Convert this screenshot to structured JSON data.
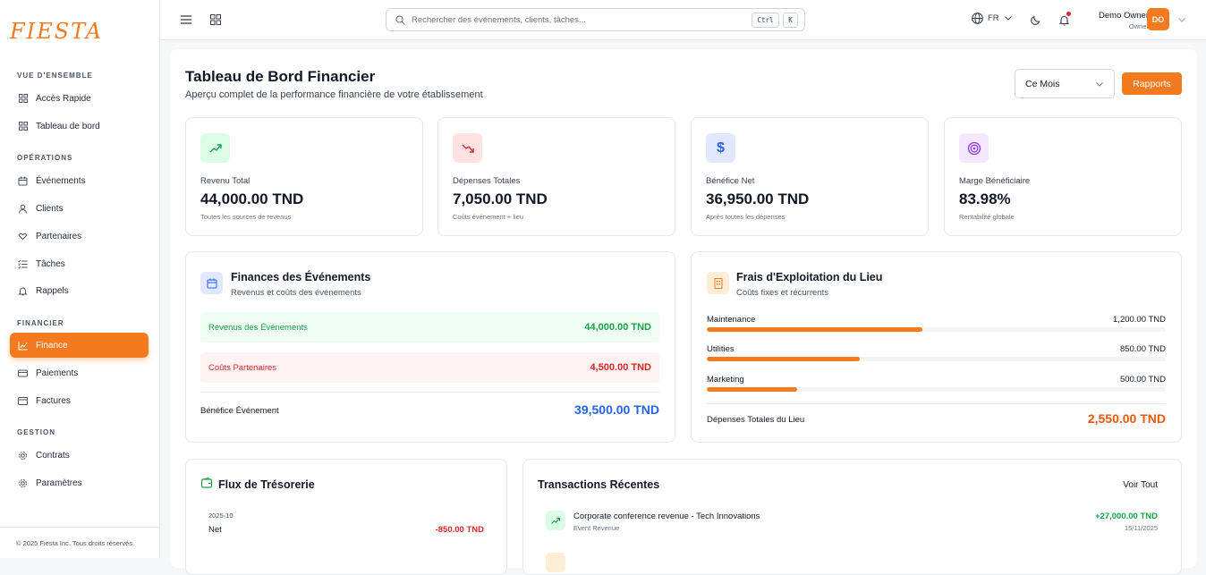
{
  "brand": {
    "logo_text": "FIESTA",
    "accent": "#f47a20"
  },
  "sidebar": {
    "sections": {
      "overview": "VUE D'ENSEMBLE",
      "operations": "OPÉRATIONS",
      "financial": "FINANCIER",
      "management": "GESTION"
    },
    "items": [
      {
        "label": "Accès Rapide",
        "icon": "grid-icon"
      },
      {
        "label": "Tableau de bord",
        "icon": "grid-icon"
      },
      {
        "label": "Événements",
        "icon": "calendar-icon"
      },
      {
        "label": "Clients",
        "icon": "user-icon"
      },
      {
        "label": "Partenaires",
        "icon": "handshake-icon"
      },
      {
        "label": "Tâches",
        "icon": "list-icon"
      },
      {
        "label": "Rappels",
        "icon": "bell-icon"
      },
      {
        "label": "Finance",
        "icon": "chart-icon",
        "active": true
      },
      {
        "label": "Paiements",
        "icon": "card-icon"
      },
      {
        "label": "Factures",
        "icon": "invoice-icon"
      },
      {
        "label": "Contrats",
        "icon": "gear-icon"
      },
      {
        "label": "Paramètres",
        "icon": "gear-icon"
      }
    ],
    "footer": "© 2025 Fiesta Inc. Tous droits réservés."
  },
  "topbar": {
    "search_placeholder": "Rechercher des événements, clients, tâches...",
    "kbd_ctrl": "Ctrl",
    "kbd_k": "K",
    "language": "FR",
    "user_name": "Demo Owner",
    "user_role": "Owner",
    "avatar_initials": "DO"
  },
  "header": {
    "title": "Tableau de Bord Financier",
    "subtitle": "Aperçu complet de la performance financière de votre établissement",
    "period": "Ce Mois",
    "reports_label": "Rapports"
  },
  "stats": [
    {
      "label": "Revenu Total",
      "value": "44,000.00 TND",
      "note": "Toutes les sources de revenus",
      "icon": "trending-up-icon",
      "color": "#16a34a",
      "bg": "#dcfce7"
    },
    {
      "label": "Dépenses Totales",
      "value": "7,050.00 TND",
      "note": "Coûts événement + lieu",
      "icon": "trending-down-icon",
      "color": "#dc2626",
      "bg": "#fee2e2"
    },
    {
      "label": "Bénéfice Net",
      "value": "36,950.00 TND",
      "note": "Après toutes les dépenses",
      "icon": "dollar-icon",
      "color": "#2563eb",
      "bg": "#e0e7ff"
    },
    {
      "label": "Marge Bénéficiaire",
      "value": "83.98%",
      "note": "Rentabilité globale",
      "icon": "target-icon",
      "color": "#9333ea",
      "bg": "#f3e8ff"
    }
  ],
  "event_finance": {
    "title": "Finances des Événements",
    "subtitle": "Revenus et coûts des événements",
    "revenue_label": "Revenus des Événements",
    "revenue_value": "44,000.00 TND",
    "costs_label": "Coûts Partenaires",
    "costs_value": "4,500.00 TND",
    "profit_label": "Bénéfice Événement",
    "profit_value": "39,500.00 TND"
  },
  "venue_costs": {
    "title": "Frais d'Exploitation du Lieu",
    "subtitle": "Coûts fixes et récurrents",
    "items": [
      {
        "label": "Maintenance",
        "value": "1,200.00 TND",
        "fraction": 0.47
      },
      {
        "label": "Utilities",
        "value": "850.00 TND",
        "fraction": 0.333
      },
      {
        "label": "Marketing",
        "value": "500.00 TND",
        "fraction": 0.196
      }
    ],
    "total_label": "Dépenses Totales du Lieu",
    "total_value": "2,550.00 TND"
  },
  "cash_flow": {
    "title": "Flux de Trésorerie",
    "period": "2025-10",
    "net_label": "Net",
    "net_value": "-850.00 TND"
  },
  "transactions": {
    "title": "Transactions Récentes",
    "see_all": "Voir Tout",
    "items": [
      {
        "title": "Corporate conference revenue - Tech Innovations",
        "category": "Event Revenue",
        "amount": "+27,000.00 TND",
        "date": "15/11/2025"
      }
    ]
  }
}
